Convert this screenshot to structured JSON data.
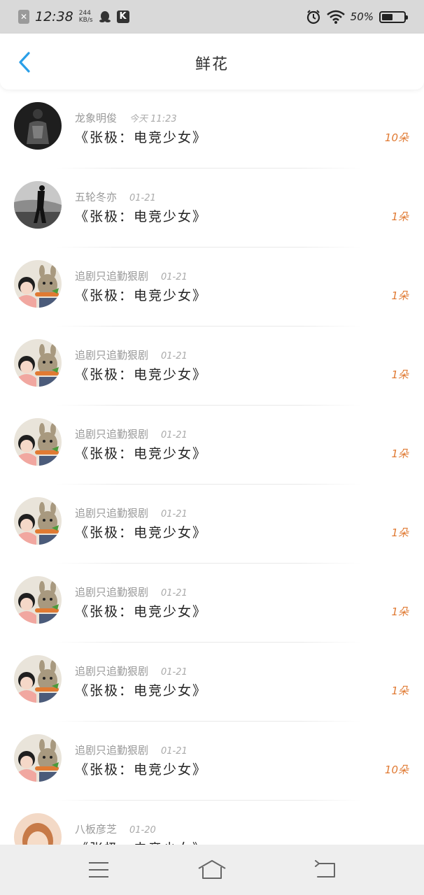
{
  "status_bar": {
    "time": "12:38",
    "net_speed_value": "244",
    "net_speed_unit": "KB/s",
    "k_app_label": "K",
    "battery_percent": "50%",
    "battery_level": 0.5
  },
  "header": {
    "title": "鲜花",
    "back_icon": "chevron-left-icon"
  },
  "colors": {
    "accent_blue": "#2a9fe8",
    "count_orange": "#e07a33",
    "status_bar_bg": "#d9d9d9",
    "nav_bar_bg": "#eeeeee"
  },
  "list": {
    "items": [
      {
        "username": "龙象明俊",
        "time": "今天 11:23",
        "book": "《张极：电竞少女》",
        "count": "10朵",
        "avatar": "dark-jacket-avatar"
      },
      {
        "username": "五轮冬亦",
        "time": "01-21",
        "book": "《张极：电竞少女》",
        "count": "1朵",
        "avatar": "bw-person-avatar"
      },
      {
        "username": "追剧只追勤狠剧",
        "time": "01-21",
        "book": "《张极：电竞少女》",
        "count": "1朵",
        "avatar": "girl-bunny-avatar"
      },
      {
        "username": "追剧只追勤狠剧",
        "time": "01-21",
        "book": "《张极：电竞少女》",
        "count": "1朵",
        "avatar": "girl-bunny-avatar"
      },
      {
        "username": "追剧只追勤狠剧",
        "time": "01-21",
        "book": "《张极：电竞少女》",
        "count": "1朵",
        "avatar": "girl-bunny-avatar"
      },
      {
        "username": "追剧只追勤狠剧",
        "time": "01-21",
        "book": "《张极：电竞少女》",
        "count": "1朵",
        "avatar": "girl-bunny-avatar"
      },
      {
        "username": "追剧只追勤狠剧",
        "time": "01-21",
        "book": "《张极：电竞少女》",
        "count": "1朵",
        "avatar": "girl-bunny-avatar"
      },
      {
        "username": "追剧只追勤狠剧",
        "time": "01-21",
        "book": "《张极：电竞少女》",
        "count": "1朵",
        "avatar": "girl-bunny-avatar"
      },
      {
        "username": "追剧只追勤狠剧",
        "time": "01-21",
        "book": "《张极：电竞少女》",
        "count": "10朵",
        "avatar": "girl-bunny-avatar"
      },
      {
        "username": "八板彦芝",
        "time": "01-20",
        "book": "《张极：电竞少女》",
        "count": "",
        "avatar": "girl-food-avatar"
      }
    ]
  },
  "nav_bar": {
    "menu_icon": "menu-icon",
    "home_icon": "home-icon",
    "back_icon": "return-icon"
  }
}
